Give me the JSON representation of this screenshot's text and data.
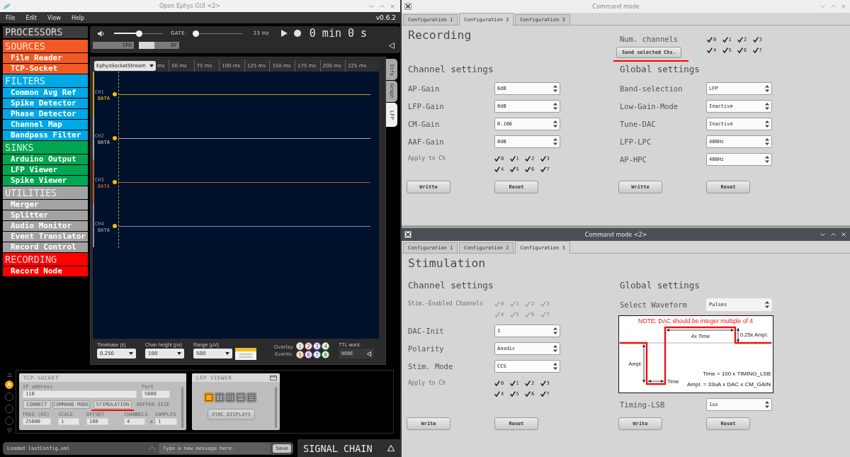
{
  "main_window": {
    "title": "Open Ephys GUI <2>",
    "menu": [
      "File",
      "Edit",
      "View",
      "Help"
    ],
    "version": "v0.6.2",
    "processor_list": {
      "title": "PROCESSORS",
      "categories": [
        {
          "name": "SOURCES",
          "color": "#f15a24",
          "items": [
            "File Reader",
            "TCP-Socket"
          ]
        },
        {
          "name": "FILTERS",
          "color": "#00a9e6",
          "items": [
            "Common Avg Ref",
            "Spike Detector",
            "Phase Detector",
            "Channel Map",
            "Bandpass Filter"
          ]
        },
        {
          "name": "SINKS",
          "color": "#00a651",
          "items": [
            "Arduino Output",
            "LFP Viewer",
            "Spike Viewer"
          ]
        },
        {
          "name": "UTILITIES",
          "color": "#a3a3a3",
          "items": [
            "Merger",
            "Splitter",
            "Audio Monitor",
            "Event Translator",
            "Record Control"
          ]
        },
        {
          "name": "RECORDING",
          "color": "#ff0000",
          "items": [
            "Record Node"
          ]
        }
      ]
    },
    "control_panel": {
      "volume": {
        "level": 0.52
      },
      "gate": {
        "label": "GATE:",
        "level": 0
      },
      "frequency": "23 Hz",
      "clock": "0 min 0 s",
      "cpu_meter": {
        "label": "CPU"
      },
      "disk_meter": {
        "label": "DF",
        "level": 0.38
      }
    },
    "lfp_viewer": {
      "stream": "EphysSocketStream",
      "time_ticks": [
        "ms",
        "50 ms",
        "75 ms",
        "100 ms",
        "125 ms",
        "150 ms",
        "175 ms",
        "200 ms",
        "225 ms"
      ],
      "channels": [
        {
          "name": "CH1",
          "tag": "DATA",
          "color": "#c9a21c"
        },
        {
          "name": "CH2",
          "tag": "DATA",
          "color": "#a8a8a8"
        },
        {
          "name": "CH3",
          "tag": "DATA",
          "color": "#c0561c"
        },
        {
          "name": "CH4",
          "tag": "DATA",
          "color": "#8a86b4"
        }
      ],
      "controls": [
        {
          "label": "Timebase (s)",
          "value": "0.250"
        },
        {
          "label": "Chan height (px)",
          "value": "100"
        },
        {
          "label": "Range (µV)",
          "value": "500"
        }
      ],
      "event_label": "Overlay Events:",
      "event_buttons": [
        {
          "label": "1",
          "color": "#b4b4b4"
        },
        {
          "label": "2",
          "color": "#e0303a"
        },
        {
          "label": "3",
          "color": "#7b3ff2"
        },
        {
          "label": "4",
          "color": "#6cc04a"
        },
        {
          "label": "5",
          "color": "#f07f1e"
        },
        {
          "label": "6",
          "color": "#d23fc8"
        },
        {
          "label": "7",
          "color": "#2f86f0"
        },
        {
          "label": "8",
          "color": "#4caf2a"
        }
      ],
      "ttl": {
        "label": "TTL word:",
        "value": "NONE"
      },
      "side_tabs": [
        {
          "label": "Info",
          "selected": false
        },
        {
          "label": "Graph",
          "selected": false
        },
        {
          "label": "LFP",
          "selected": true
        }
      ]
    },
    "signal_chain": {
      "slots": [
        {
          "label": "A",
          "selected": true
        },
        {
          "selected": false
        },
        {
          "selected": false
        },
        {
          "selected": false
        }
      ],
      "editors": [
        {
          "kind": "tcp_socket",
          "title": "TCP-SOCKET",
          "fields": [
            {
              "label": "IP address",
              "value": "110"
            },
            {
              "label": "Port",
              "value": "5000"
            }
          ],
          "buttons": [
            {
              "label": "CONNECT",
              "underlined": false
            },
            {
              "label": "COMMAND MODE",
              "underlined": false
            },
            {
              "label": "STIMULATION",
              "underlined": true
            }
          ],
          "buffer_label": "BUFFER SIZE",
          "params": [
            {
              "label": "FREQ (HZ)",
              "value": "25000"
            },
            {
              "label": "SCALE",
              "value": "1"
            },
            {
              "label": "OFFSET",
              "value": "100"
            },
            {
              "label": "CHANNELS",
              "value": "4"
            },
            {
              "label": "SAMPLES",
              "value": "1"
            }
          ],
          "separator": "x"
        },
        {
          "kind": "lfp_viewer",
          "title": "LFP VIEWER",
          "layouts": [
            {
              "kind": "single",
              "selected": true
            },
            {
              "kind": "two_columns",
              "selected": false
            },
            {
              "kind": "three_columns",
              "selected": false
            },
            {
              "kind": "two_rows",
              "selected": false
            },
            {
              "kind": "three_rows",
              "selected": false
            }
          ],
          "button": "SYNC DISPLAYS"
        }
      ]
    },
    "status_bar": {
      "message": "Loaded lastConfig.xml",
      "note": {
        "placeholder": "Type a new message here."
      },
      "save_button": "Save",
      "signal_chain_toggle": "SIGNAL CHAIN"
    }
  },
  "command_windows": [
    {
      "title": "Command mode",
      "active": false,
      "tabs": [
        {
          "label": "Configuration 1",
          "selected": false
        },
        {
          "label": "Configuration 2",
          "selected": true
        },
        {
          "label": "Configuration 3",
          "selected": false
        }
      ],
      "heading": "Recording",
      "header_controls": {
        "label": "Num. channels",
        "checks": [
          {
            "label": "0",
            "checked": true
          },
          {
            "label": "1",
            "checked": true
          },
          {
            "label": "2",
            "checked": true
          },
          {
            "label": "3",
            "checked": true
          },
          {
            "label": "4",
            "checked": true
          },
          {
            "label": "5",
            "checked": true
          },
          {
            "label": "6",
            "checked": true
          },
          {
            "label": "7",
            "checked": true
          }
        ],
        "button": {
          "label": "Send selected Chs.",
          "underlined": true
        }
      },
      "columns": [
        {
          "title": "Channel settings",
          "rows": [
            {
              "kind": "select",
              "label": "AP-Gain",
              "value": "6dB"
            },
            {
              "kind": "select",
              "label": "LFP-Gain",
              "value": "0dB"
            },
            {
              "kind": "select",
              "label": "CM-Gain",
              "value": "0.166"
            },
            {
              "kind": "select",
              "label": "AAF-Gain",
              "value": "0dB"
            },
            {
              "kind": "checks",
              "label": "Apply to Ch",
              "disabled": false,
              "checks": [
                {
                  "label": "0",
                  "checked": true
                },
                {
                  "label": "1",
                  "checked": true
                },
                {
                  "label": "2",
                  "checked": true
                },
                {
                  "label": "3",
                  "checked": true
                },
                {
                  "label": "4",
                  "checked": true
                },
                {
                  "label": "5",
                  "checked": true
                },
                {
                  "label": "6",
                  "checked": true
                },
                {
                  "label": "7",
                  "checked": true
                }
              ]
            }
          ],
          "buttons": [
            "Writte",
            "Reset"
          ]
        },
        {
          "title": "Global settings",
          "rows": [
            {
              "kind": "select",
              "label": "Band-selection",
              "value": "LFP"
            },
            {
              "kind": "select",
              "label": "Low-Gain-Mode",
              "value": "Inactive"
            },
            {
              "kind": "select",
              "label": "Tune-DAC",
              "value": "Inactive"
            },
            {
              "kind": "select",
              "label": "LFP-LPC",
              "value": "400Hz"
            },
            {
              "kind": "select",
              "label": "AP-HPC",
              "value": "400Hz"
            }
          ],
          "buttons": [
            "Writte",
            "Reset"
          ]
        }
      ]
    },
    {
      "title": "Command mode <2>",
      "active": true,
      "tabs": [
        {
          "label": "Configuration 1",
          "selected": false
        },
        {
          "label": "Configuration 2",
          "selected": false
        },
        {
          "label": "Configuration 3",
          "selected": true
        }
      ],
      "heading": "Stimulation",
      "columns": [
        {
          "title": "Channel settings",
          "rows": [
            {
              "kind": "checks",
              "label": "Stim.-Enabled Channels",
              "disabled": true,
              "checks": [
                {
                  "label": "0",
                  "checked": true
                },
                {
                  "label": "1",
                  "checked": true
                },
                {
                  "label": "2",
                  "checked": true
                },
                {
                  "label": "3",
                  "checked": true
                },
                {
                  "label": "4",
                  "checked": true
                },
                {
                  "label": "5",
                  "checked": true
                },
                {
                  "label": "6",
                  "checked": true
                },
                {
                  "label": "7",
                  "checked": true
                }
              ]
            },
            {
              "kind": "select",
              "label": "DAC-Init",
              "value": "1"
            },
            {
              "kind": "select",
              "label": "Polarity",
              "value": "Anodic"
            },
            {
              "kind": "select",
              "label": "Stim. Mode",
              "value": "CCS"
            },
            {
              "kind": "checks",
              "label": "Apply to Ch",
              "disabled": false,
              "checks": [
                {
                  "label": "0",
                  "checked": true
                },
                {
                  "label": "1",
                  "checked": true
                },
                {
                  "label": "2",
                  "checked": true
                },
                {
                  "label": "3",
                  "checked": true
                },
                {
                  "label": "4",
                  "checked": true
                },
                {
                  "label": "5",
                  "checked": true
                },
                {
                  "label": "6",
                  "checked": true
                },
                {
                  "label": "7",
                  "checked": true
                }
              ]
            }
          ],
          "buttons": [
            "Write",
            "Reset"
          ]
        },
        {
          "title": "Global settings",
          "rows": [
            {
              "kind": "combo",
              "label": "Select Waveform",
              "value": "Pulses"
            },
            {
              "kind": "diagram",
              "note": "NOTE: DAC should be integer multiple of 4",
              "labels": [
                "4x Time",
                "0.25x Ampl.",
                "Ampl.",
                "Time"
              ],
              "formulas": [
                "Time = 100 x TIMING_LSB",
                "Ampl. = 33uA x DAC x CM_GAIN"
              ]
            },
            {
              "kind": "select",
              "label": "Timing-LSB",
              "value": "1us"
            }
          ],
          "buttons": [
            "Write",
            "Reset"
          ]
        }
      ]
    }
  ]
}
